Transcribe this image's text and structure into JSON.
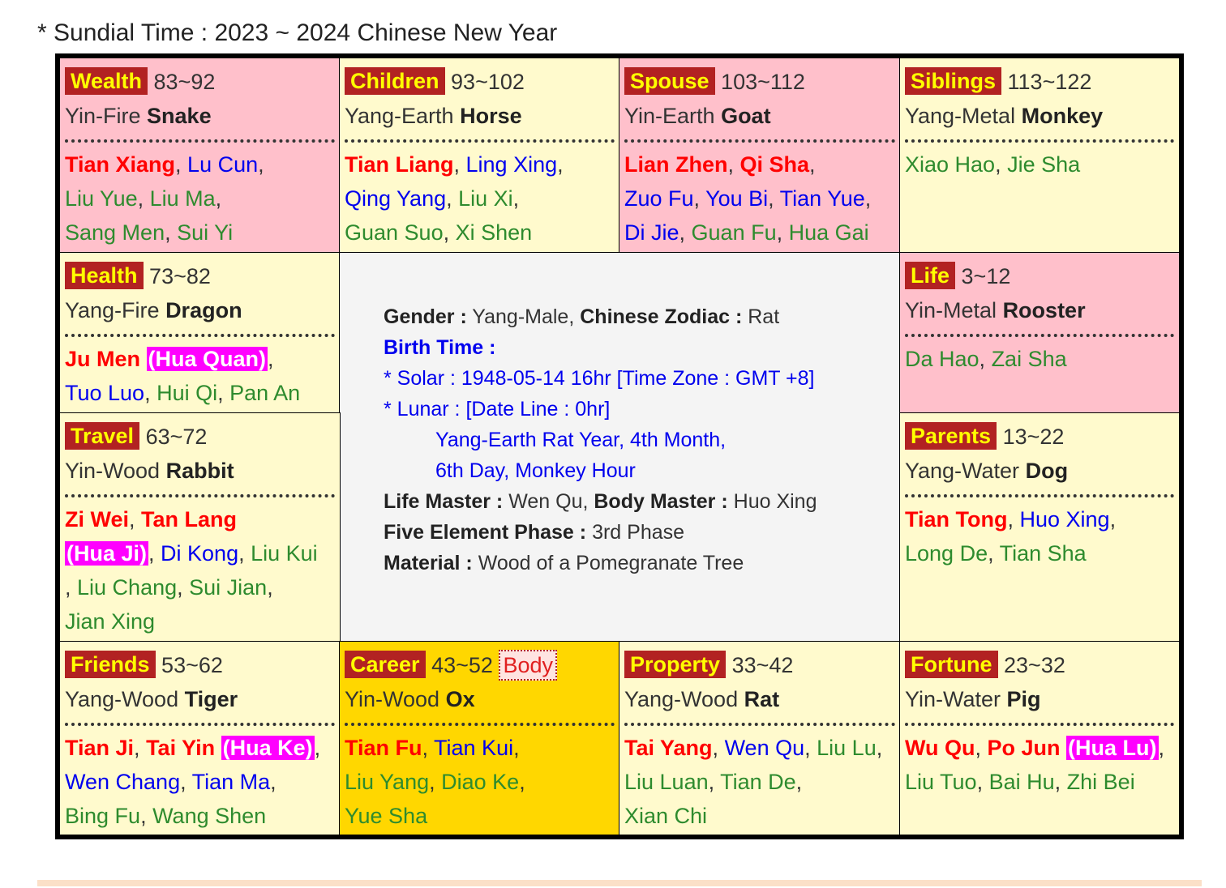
{
  "header": {
    "title": "* Sundial Time : 2023 ~ 2024 Chinese New Year"
  },
  "colors": {
    "palace_bg": "#b22222",
    "palace_text": "#ffff00",
    "major_star": "#ff0000",
    "minor_star": "#0000ee",
    "misc_star": "#2e8b2e",
    "transform": "#ff00ff",
    "pink_cell": "#ffc0cb",
    "cream_cell": "#fffacd",
    "career_cell": "#ffd700"
  },
  "palaces": {
    "wealth": {
      "name": "Wealth",
      "range": "83~92",
      "stem": "Yin-Fire",
      "animal": "Snake",
      "l1": [
        "Tian Xiang",
        ", ",
        "Lu Cun",
        ","
      ],
      "l2": [
        "Liu Yue",
        ", ",
        "Liu Ma",
        ","
      ],
      "l3": [
        "Sang Men",
        ", ",
        "Sui Yi"
      ]
    },
    "children": {
      "name": "Children",
      "range": "93~102",
      "stem": "Yang-Earth",
      "animal": "Horse",
      "l1": [
        "Tian Liang",
        ", ",
        "Ling Xing",
        ","
      ],
      "l2": [
        "Qing Yang",
        ", ",
        "Liu Xi",
        ","
      ],
      "l3": [
        "Guan Suo",
        ", ",
        "Xi Shen"
      ]
    },
    "spouse": {
      "name": "Spouse",
      "range": "103~112",
      "stem": "Yin-Earth",
      "animal": "Goat",
      "l1": [
        "Lian Zhen",
        ", ",
        "Qi Sha",
        ","
      ],
      "l2": [
        "Zuo Fu",
        ", ",
        "You Bi",
        ", ",
        "Tian Yue",
        ","
      ],
      "l3": [
        "Di Jie",
        ", ",
        "Guan Fu",
        ", ",
        "Hua Gai"
      ]
    },
    "siblings": {
      "name": "Siblings",
      "range": "113~122",
      "stem": "Yang-Metal",
      "animal": "Monkey",
      "l1": [
        "Xiao Hao",
        ", ",
        "Jie Sha"
      ]
    },
    "health": {
      "name": "Health",
      "range": "73~82",
      "stem": "Yang-Fire",
      "animal": "Dragon",
      "l1": [
        "Ju Men",
        " ",
        "(Hua Quan)",
        ","
      ],
      "l2": [
        "Tuo Luo",
        ", ",
        "Hui Qi",
        ", ",
        "Pan An"
      ]
    },
    "life": {
      "name": "Life",
      "range": "3~12",
      "stem": "Yin-Metal",
      "animal": "Rooster",
      "l1": [
        "Da Hao",
        ", ",
        "Zai Sha"
      ]
    },
    "travel": {
      "name": "Travel",
      "range": "63~72",
      "stem": "Yin-Wood",
      "animal": "Rabbit",
      "l1": [
        "Zi Wei",
        ", ",
        "Tan Lang"
      ],
      "l2": [
        "(Hua Ji)",
        ", ",
        "Di Kong",
        ", ",
        "Liu Kui"
      ],
      "l3": [
        ", ",
        "Liu Chang",
        ", ",
        "Sui Jian",
        ","
      ],
      "l4": [
        "Jian Xing"
      ]
    },
    "parents": {
      "name": "Parents",
      "range": "13~22",
      "stem": "Yang-Water",
      "animal": "Dog",
      "l1": [
        "Tian Tong",
        ", ",
        "Huo Xing",
        ","
      ],
      "l2": [
        "Long De",
        ", ",
        "Tian Sha"
      ]
    },
    "friends": {
      "name": "Friends",
      "range": "53~62",
      "stem": "Yang-Wood",
      "animal": "Tiger",
      "l1": [
        "Tian Ji",
        ", ",
        "Tai Yin",
        " ",
        "(Hua Ke)",
        ","
      ],
      "l2": [
        "Wen Chang",
        ", ",
        "Tian Ma",
        ","
      ],
      "l3": [
        "Bing Fu",
        ", ",
        "Wang Shen"
      ]
    },
    "career": {
      "name": "Career",
      "range": "43~52",
      "body": "Body",
      "stem": "Yin-Wood",
      "animal": "Ox",
      "l1": [
        "Tian Fu",
        ", ",
        "Tian Kui",
        ","
      ],
      "l2": [
        "Liu Yang",
        ", ",
        "Diao Ke",
        ","
      ],
      "l3": [
        "Yue Sha"
      ]
    },
    "property": {
      "name": "Property",
      "range": "33~42",
      "stem": "Yang-Wood",
      "animal": "Rat",
      "l1": [
        "Tai Yang",
        ", ",
        "Wen Qu",
        ", ",
        "Liu Lu",
        ","
      ],
      "l2": [
        "Liu Luan",
        ", ",
        "Tian De",
        ","
      ],
      "l3": [
        "Xian Chi"
      ]
    },
    "fortune": {
      "name": "Fortune",
      "range": "23~32",
      "stem": "Yin-Water",
      "animal": "Pig",
      "l1": [
        "Wu Qu",
        ", ",
        "Po Jun",
        " ",
        "(Hua Lu)",
        ","
      ],
      "l2": [
        "Liu Tuo",
        ", ",
        "Bai Hu",
        ", ",
        "Zhi Bei"
      ]
    }
  },
  "center": {
    "gender_label": "Gender :",
    "gender": "Yang-Male,",
    "zodiac_label": "Chinese Zodiac :",
    "zodiac": "Rat",
    "birth_label": "Birth Time :",
    "solar": "* Solar : 1948-05-14 16hr [Time Zone : GMT +8]",
    "lunar": "* Lunar : [Date Line : 0hr]",
    "lunar_l1": "Yang-Earth Rat Year, 4th Month,",
    "lunar_l2": "6th Day, Monkey Hour",
    "life_master_label": "Life Master :",
    "life_master": "Wen Qu,",
    "body_master_label": "Body Master :",
    "body_master": "Huo Xing",
    "phase_label": "Five Element Phase :",
    "phase": "3rd Phase",
    "material_label": "Material :",
    "material": "Wood of a Pomegranate Tree"
  }
}
